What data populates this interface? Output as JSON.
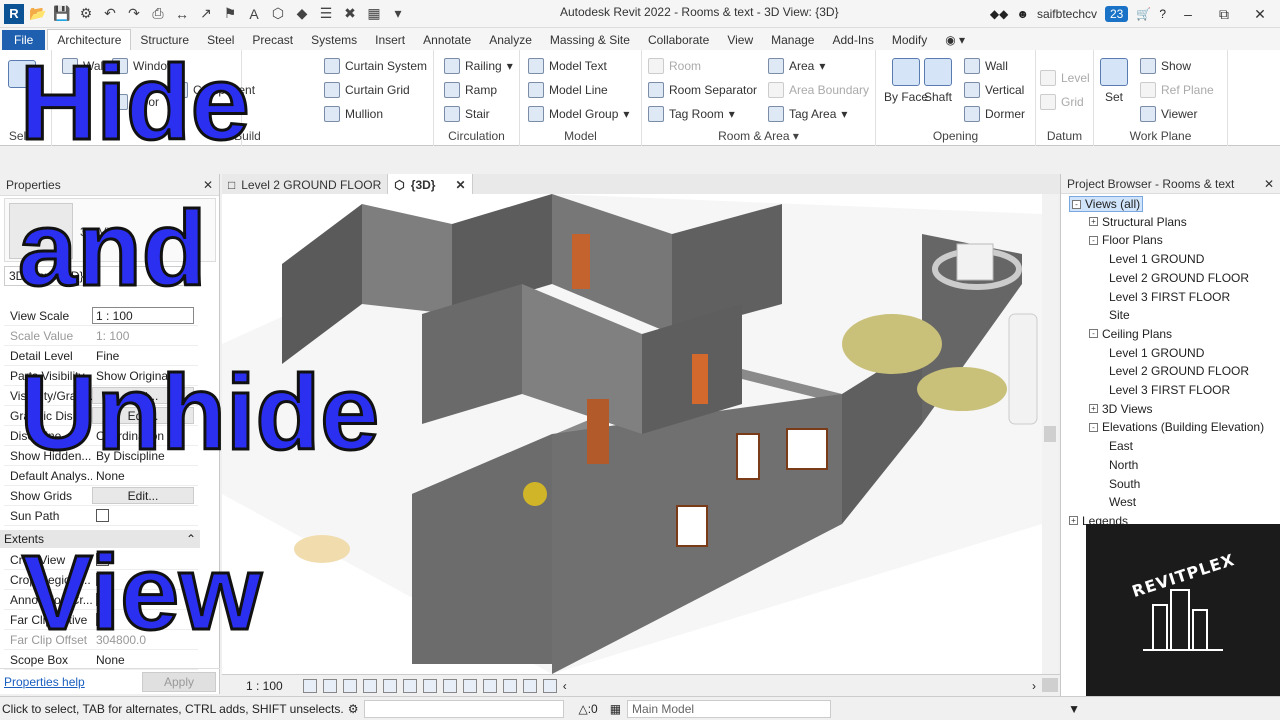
{
  "titlebar": {
    "title": "Autodesk Revit 2022 - Rooms & text - 3D View: {3D}",
    "user": "saifbtechcv",
    "notifications": "23",
    "help": "?"
  },
  "tabs": [
    "File",
    "Architecture",
    "Structure",
    "Steel",
    "Precast",
    "Systems",
    "Insert",
    "Annotate",
    "Analyze",
    "Massing & Site",
    "Collaborate",
    "View",
    "Manage",
    "Add-Ins",
    "Modify"
  ],
  "ribbon": {
    "select_group": "Select",
    "build_group": "Build",
    "build_items": {
      "wall": "Wall",
      "door": "Door",
      "window": "Window",
      "component": "Component",
      "curtain_system": "Curtain System",
      "curtain_grid": "Curtain Grid",
      "mullion": "Mullion"
    },
    "circulation": {
      "title": "Circulation",
      "railing": "Railing",
      "ramp": "Ramp",
      "stair": "Stair"
    },
    "model": {
      "title": "Model",
      "text": "Model Text",
      "line": "Model Line",
      "group": "Model Group"
    },
    "room_area": {
      "title": "Room & Area",
      "room": "Room",
      "separator": "Room Separator",
      "tag_room": "Tag Room",
      "area": "Area",
      "area_boundary": "Area Boundary",
      "tag_area": "Tag Area"
    },
    "opening": {
      "title": "Opening",
      "by_face": "By Face",
      "shaft": "Shaft",
      "wall": "Wall",
      "vertical": "Vertical",
      "dormer": "Dormer"
    },
    "datum": {
      "title": "Datum",
      "level": "Level",
      "grid": "Grid"
    },
    "work_plane": {
      "title": "Work Plane",
      "set": "Set",
      "show": "Show",
      "ref_plane": "Ref Plane",
      "viewer": "Viewer"
    }
  },
  "properties": {
    "title": "Properties",
    "type_name": "3D View",
    "filter_value": "3D View: {3D}",
    "rows": [
      {
        "k": "View Scale",
        "v": "1 : 100"
      },
      {
        "k": "Scale Value",
        "v": "1:  100"
      },
      {
        "k": "Detail Level",
        "v": "Fine"
      },
      {
        "k": "Parts Visibility",
        "v": "Show Original"
      },
      {
        "k": "Visibility/Grap...",
        "v": "Edit..."
      },
      {
        "k": "Graphic Displ...",
        "v": "Edit..."
      },
      {
        "k": "Discipline",
        "v": "Coordination"
      },
      {
        "k": "Show Hidden...",
        "v": "By Discipline"
      },
      {
        "k": "Default Analys...",
        "v": "None"
      },
      {
        "k": "Show Grids",
        "v": "Edit..."
      },
      {
        "k": "Sun Path",
        "v": ""
      }
    ],
    "extents_title": "Extents",
    "extent_rows": [
      {
        "k": "Crop View",
        "v": ""
      },
      {
        "k": "Crop Region ...",
        "v": ""
      },
      {
        "k": "Annotation Cr...",
        "v": ""
      },
      {
        "k": "Far Clip Active",
        "v": ""
      },
      {
        "k": "Far Clip Offset",
        "v": "304800.0"
      },
      {
        "k": "Scope Box",
        "v": "None"
      }
    ],
    "help_link": "Properties help",
    "apply": "Apply"
  },
  "view_tabs": [
    {
      "label": "Level 2 GROUND FLOOR"
    },
    {
      "label": "{3D}"
    }
  ],
  "view_control": {
    "scale": "1 : 100"
  },
  "browser": {
    "title": "Project Browser - Rooms & text",
    "nodes": [
      {
        "label": "Views (all)",
        "level": 0,
        "exp": "-",
        "sel": true
      },
      {
        "label": "Structural Plans",
        "level": 1,
        "exp": "+"
      },
      {
        "label": "Floor Plans",
        "level": 1,
        "exp": "-"
      },
      {
        "label": "Level 1 GROUND",
        "level": 2
      },
      {
        "label": "Level 2 GROUND FLOOR",
        "level": 2
      },
      {
        "label": "Level 3 FIRST FLOOR",
        "level": 2
      },
      {
        "label": "Site",
        "level": 2
      },
      {
        "label": "Ceiling Plans",
        "level": 1,
        "exp": "-"
      },
      {
        "label": "Level 1 GROUND",
        "level": 2
      },
      {
        "label": "Level 2 GROUND FLOOR",
        "level": 2
      },
      {
        "label": "Level 3 FIRST FLOOR",
        "level": 2
      },
      {
        "label": "3D Views",
        "level": 1,
        "exp": "+"
      },
      {
        "label": "Elevations (Building Elevation)",
        "level": 1,
        "exp": "-"
      },
      {
        "label": "East",
        "level": 2
      },
      {
        "label": "North",
        "level": 2
      },
      {
        "label": "South",
        "level": 2
      },
      {
        "label": "West",
        "level": 2
      },
      {
        "label": "Legends",
        "level": 0,
        "exp": "+"
      }
    ]
  },
  "logo_text": "REVITPLEX",
  "status": {
    "hint": "Click to select, TAB for alternates, CTRL adds, SHIFT unselects.",
    "count": ":0",
    "model": "Main Model"
  },
  "overlay": {
    "line1": "Hide",
    "line2": "and",
    "line3": "Unhide",
    "line4": "View"
  },
  "colors": {
    "file_tab": "#1e5fb0",
    "overlay_fill": "#2a2ff0",
    "wall_grey": "#6e6e6e",
    "floor": "#ffffff"
  }
}
